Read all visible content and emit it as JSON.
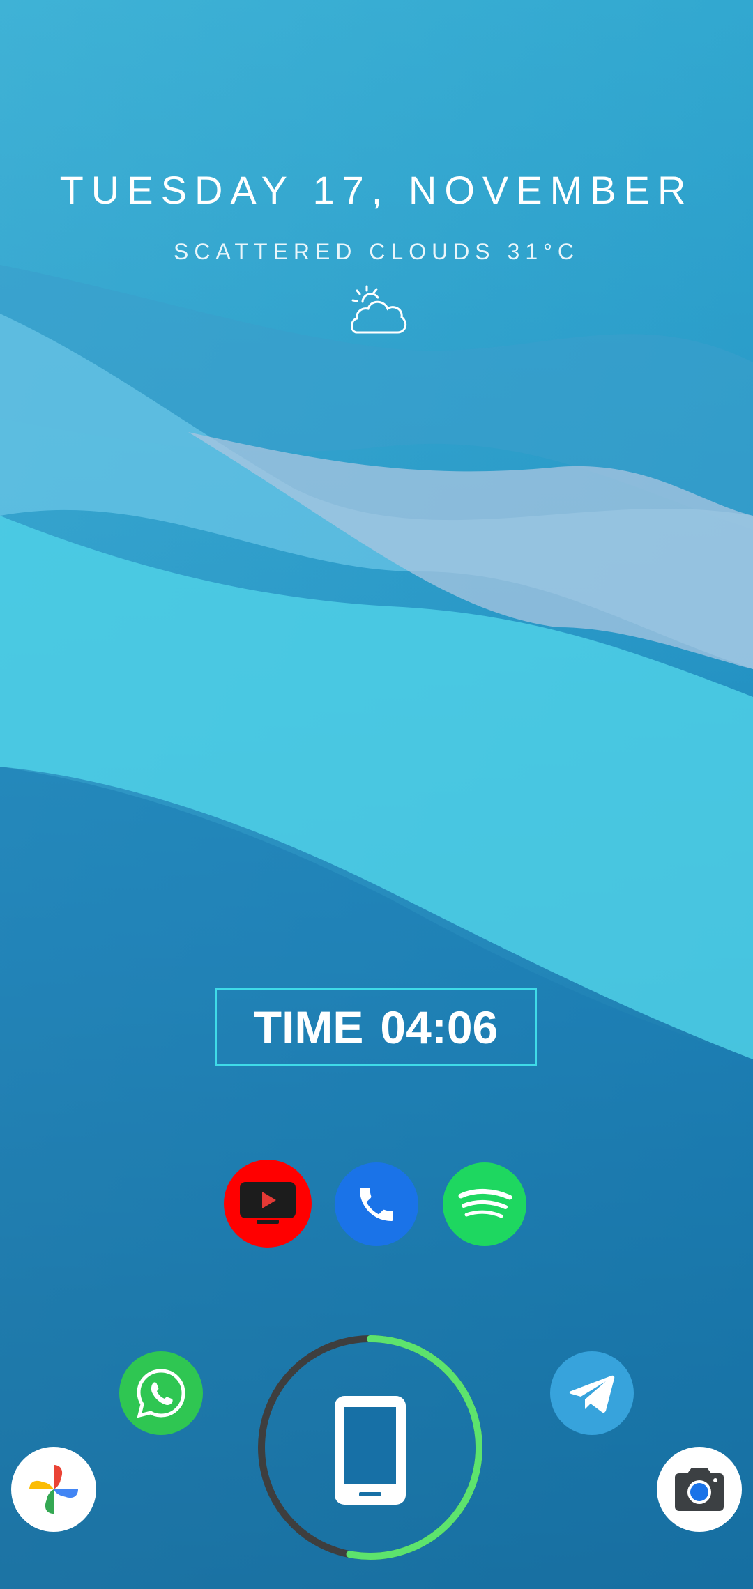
{
  "lockscreen": {
    "date": "TUESDAY 17, NOVEMBER",
    "weather": "SCATTERED CLOUDS 31°C",
    "weather_icon": "partly-cloudy-icon",
    "clock": {
      "label": "TIME",
      "time": "04:06",
      "border_color": "#3fdbe8"
    }
  },
  "apps": {
    "row": [
      {
        "name": "YouTube",
        "icon": "youtube-tv-icon",
        "color": "#ff0000"
      },
      {
        "name": "Phone",
        "icon": "phone-icon",
        "color": "#1a73e8"
      },
      {
        "name": "Spotify",
        "icon": "spotify-icon",
        "color": "#1ed760"
      }
    ],
    "bottom": [
      {
        "name": "WhatsApp",
        "icon": "whatsapp-icon",
        "color": "#2fc652"
      },
      {
        "name": "Telegram",
        "icon": "telegram-icon",
        "color": "#37a3dc"
      },
      {
        "name": "Photos",
        "icon": "google-photos-icon",
        "color": "#ffffff"
      },
      {
        "name": "Camera",
        "icon": "camera-icon",
        "color": "#ffffff"
      }
    ]
  },
  "battery_ring": {
    "level_fraction": 0.53,
    "fill_color": "#5de36d",
    "track_color": "#3e3e3e",
    "icon": "smartphone-icon"
  }
}
